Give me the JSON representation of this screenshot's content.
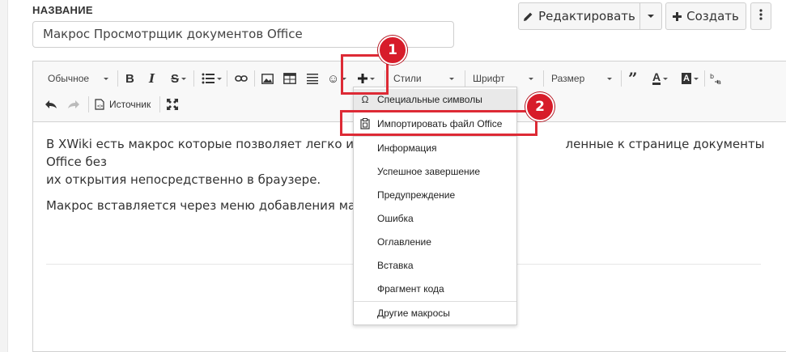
{
  "page": {
    "title_label": "НАЗВАНИЕ",
    "title_value": "Макрос Просмотрщик документов Office"
  },
  "actions": {
    "edit_label": "Редактировать",
    "create_label": "Создать"
  },
  "toolbar": {
    "format_label": "Обычное",
    "styles_label": "Стили",
    "font_label": "Шрифт",
    "size_label": "Размер",
    "source_label": "Источник"
  },
  "content": {
    "paragraph1_start": "В XWiki есть макрос которые позволяет легко и прос",
    "paragraph1_end": "ленные к странице документы Office без",
    "paragraph1_line2": "их открытия непосредственно в браузере.",
    "paragraph2": "Макрос вставляется через меню добавления макрос"
  },
  "callouts": {
    "one": "1",
    "two": "2"
  },
  "insert_menu": {
    "items": [
      {
        "label": "Специальные символы",
        "icon": "omega-icon"
      },
      {
        "label": "Импортировать файл Office",
        "icon": "office-file-icon"
      },
      {
        "label": "Информация"
      },
      {
        "label": "Успешное завершение"
      },
      {
        "label": "Предупреждение"
      },
      {
        "label": "Ошибка"
      },
      {
        "label": "Оглавление"
      },
      {
        "label": "Вставка"
      },
      {
        "label": "Фрагмент кода"
      },
      {
        "label": "Другие макросы"
      }
    ]
  },
  "colors": {
    "callout_red": "#d71c2a",
    "highlight_red": "#dd2a35"
  }
}
